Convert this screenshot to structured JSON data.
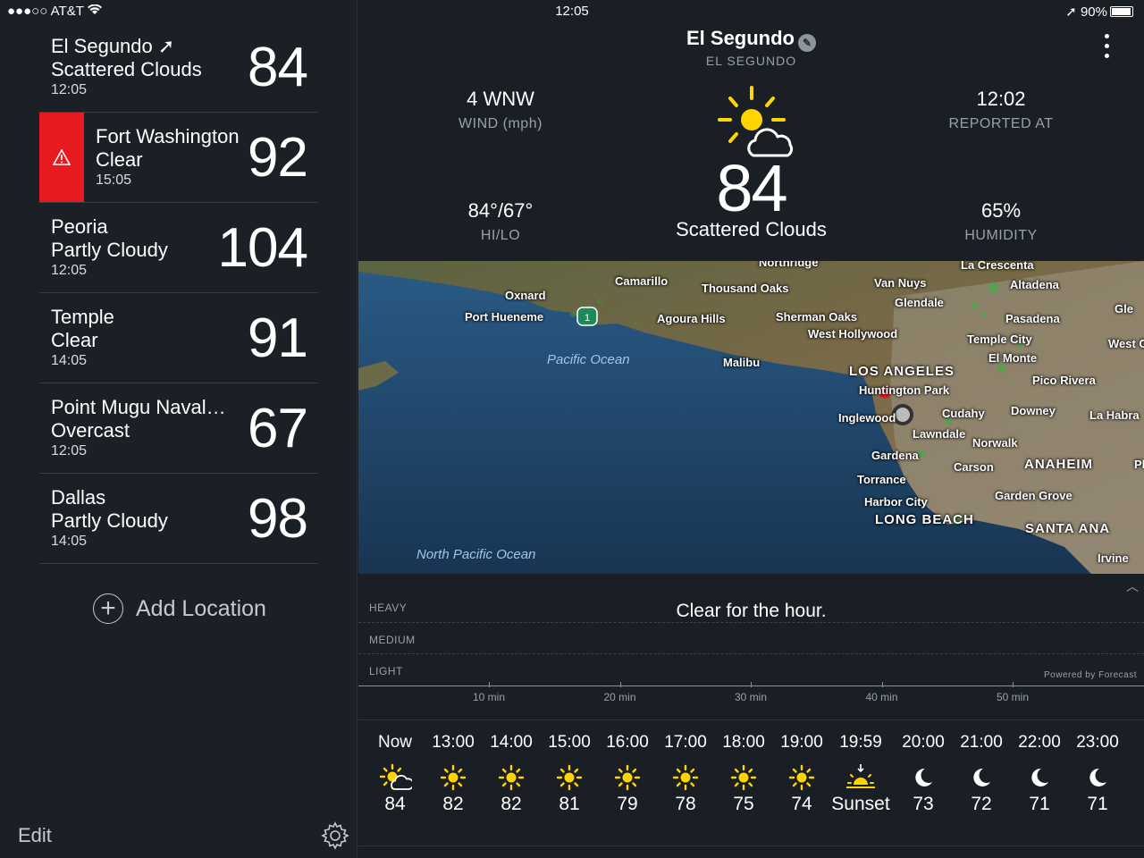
{
  "status": {
    "carrier": "●●●○○ AT&T",
    "time": "12:05",
    "battery": "90%"
  },
  "sidebar": {
    "locations": [
      {
        "name": "El Segundo ➚",
        "condition": "Scattered Clouds",
        "time": "12:05",
        "temp": "84",
        "alert": false
      },
      {
        "name": "Fort Washington",
        "condition": "Clear",
        "time": "15:05",
        "temp": "92",
        "alert": true
      },
      {
        "name": "Peoria",
        "condition": "Partly Cloudy",
        "time": "12:05",
        "temp": "104",
        "alert": false
      },
      {
        "name": "Temple",
        "condition": "Clear",
        "time": "14:05",
        "temp": "91",
        "alert": false
      },
      {
        "name": "Point Mugu Naval…",
        "condition": "Overcast",
        "time": "12:05",
        "temp": "67",
        "alert": false
      },
      {
        "name": "Dallas",
        "condition": "Partly Cloudy",
        "time": "14:05",
        "temp": "98",
        "alert": false
      }
    ],
    "add_location": "Add Location",
    "edit": "Edit"
  },
  "current": {
    "city": "El Segundo",
    "city_sub": "EL SEGUNDO",
    "wind_value": "4 WNW",
    "wind_label": "WIND (mph)",
    "reported_value": "12:02",
    "reported_label": "REPORTED AT",
    "hilo_value": "84°/67°",
    "hilo_label": "HI/LO",
    "humidity_value": "65%",
    "humidity_label": "HUMIDITY",
    "temp": "84",
    "condition": "Scattered Clouds"
  },
  "map": {
    "labels": [
      "Camarillo",
      "Oxnard",
      "Port Hueneme",
      "Thousand Oaks",
      "Agoura Hills",
      "Sherman Oaks",
      "West Hollywood",
      "Van Nuys",
      "Glendale",
      "La Crescenta",
      "Altadena",
      "Pasadena",
      "Temple City",
      "El Monte",
      "West C",
      "Gle",
      "Malibu",
      "LOS ANGELES",
      "Huntington Park",
      "Inglewood",
      "Cudahy",
      "Downey",
      "Pico Rivera",
      "La Habra",
      "Lawndale",
      "Norwalk",
      "Gardena",
      "Carson",
      "ANAHEIM",
      "Torrance",
      "Harbor City",
      "Garden Grove",
      "LONG BEACH",
      "SANTA ANA",
      "Irvine",
      "Northridge",
      "Pla"
    ],
    "oceans": [
      "Pacific Ocean",
      "North Pacific Ocean"
    ],
    "route": "1"
  },
  "precip": {
    "levels": [
      "HEAVY",
      "MEDIUM",
      "LIGHT"
    ],
    "message": "Clear for the hour.",
    "powered": "Powered by Forecast",
    "ticks": [
      "10 min",
      "20 min",
      "30 min",
      "40 min",
      "50 min"
    ]
  },
  "hourly": [
    {
      "time": "Now",
      "icon": "sun-cloud-icon",
      "temp": "84"
    },
    {
      "time": "13:00",
      "icon": "sun-icon",
      "temp": "82"
    },
    {
      "time": "14:00",
      "icon": "sun-icon",
      "temp": "82"
    },
    {
      "time": "15:00",
      "icon": "sun-icon",
      "temp": "81"
    },
    {
      "time": "16:00",
      "icon": "sun-icon",
      "temp": "79"
    },
    {
      "time": "17:00",
      "icon": "sun-icon",
      "temp": "78"
    },
    {
      "time": "18:00",
      "icon": "sun-icon",
      "temp": "75"
    },
    {
      "time": "19:00",
      "icon": "sun-icon",
      "temp": "74"
    },
    {
      "time": "19:59",
      "icon": "sunset-icon",
      "temp": "Sunset"
    },
    {
      "time": "20:00",
      "icon": "moon-icon",
      "temp": "73"
    },
    {
      "time": "21:00",
      "icon": "moon-icon",
      "temp": "72"
    },
    {
      "time": "22:00",
      "icon": "moon-icon",
      "temp": "71"
    },
    {
      "time": "23:00",
      "icon": "moon-icon",
      "temp": "71"
    }
  ],
  "colors": {
    "sun": "#ffd400",
    "alert": "#e8191f",
    "background": "#1a1f26"
  }
}
